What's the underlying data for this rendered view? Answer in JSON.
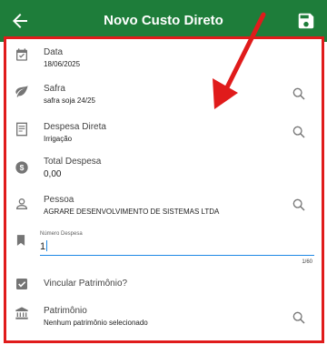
{
  "appbar": {
    "title": "Novo Custo Direto"
  },
  "fields": [
    {
      "label": "Data",
      "value": "18/06/2025"
    },
    {
      "label": "Safra",
      "value": "safra soja 24/25"
    },
    {
      "label": "Despesa Direta",
      "value": "Irrigação"
    },
    {
      "label": "Total Despesa",
      "value": "0,00"
    },
    {
      "label": "Pessoa",
      "value": "AGRARE DESENVOLVIMENTO DE SISTEMAS LTDA"
    }
  ],
  "numero_despesa": {
    "label": "Número Despesa",
    "value": "1",
    "counter": "1/60"
  },
  "vincular": {
    "label": "Vincular Patrimônio?",
    "checked": true
  },
  "patrimonio": {
    "label": "Patrimônio",
    "value": "Nenhum patrimônio selecionado"
  },
  "colors": {
    "appbar": "#1e7d3a",
    "highlight": "#e01b1b",
    "accent": "#1e88e5",
    "icon": "#757575"
  },
  "icons": [
    "back-arrow-icon",
    "save-icon",
    "calendar-icon",
    "leaf-icon",
    "receipt-icon",
    "dollar-icon",
    "person-icon",
    "bookmark-icon",
    "checkbox-icon",
    "bank-icon",
    "search-icon"
  ]
}
